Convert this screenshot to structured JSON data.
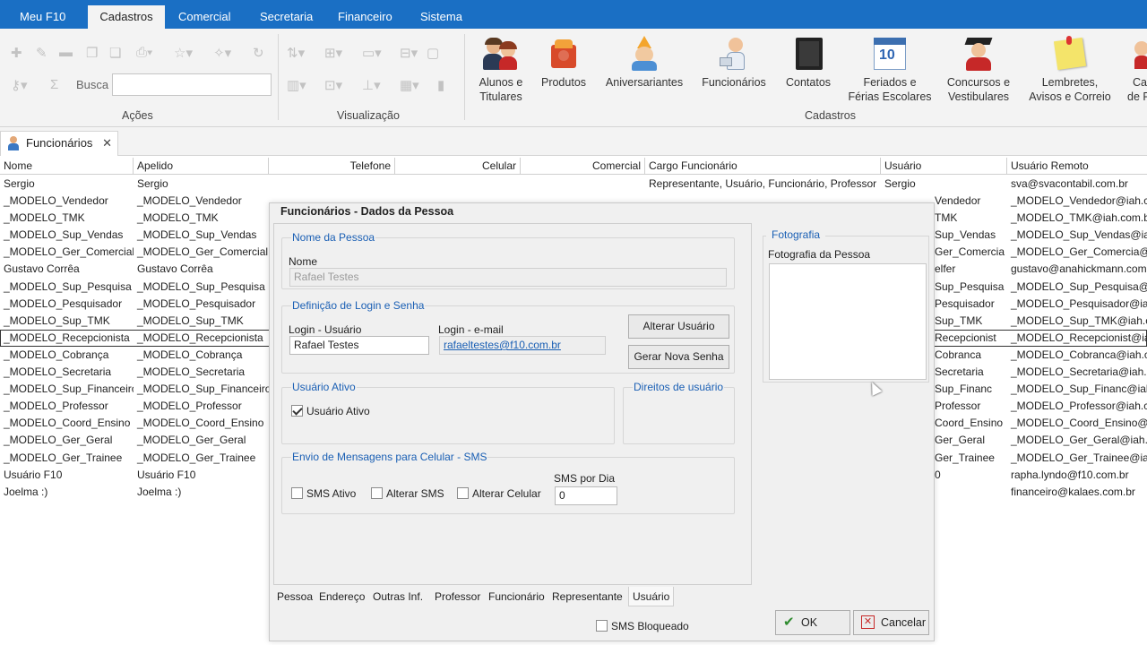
{
  "ribbon_tabs": [
    "Meu F10",
    "Cadastros",
    "Comercial",
    "Secretaria",
    "Financeiro",
    "Sistema"
  ],
  "ribbon": {
    "acoes_label": "Ações",
    "visualizacao_label": "Visualização",
    "cadastros_label": "Cadastros",
    "busca_label": "Busca",
    "busca_value": "",
    "buttons": [
      {
        "line1": "Alunos e",
        "line2": "Titulares",
        "icon": "students-icon"
      },
      {
        "line1": "Produtos",
        "line2": "",
        "icon": "products-icon"
      },
      {
        "line1": "Aniversariantes",
        "line2": "",
        "icon": "birthday-icon"
      },
      {
        "line1": "Funcionários",
        "line2": "",
        "icon": "employees-icon"
      },
      {
        "line1": "Contatos",
        "line2": "",
        "icon": "contacts-icon"
      },
      {
        "line1": "Feriados e",
        "line2": "Férias Escolares",
        "icon": "calendar-icon"
      },
      {
        "line1": "Concursos e",
        "line2": "Vestibulares",
        "icon": "graduation-icon"
      },
      {
        "line1": "Lembretes,",
        "line2": "Avisos e Correio",
        "icon": "notes-icon"
      },
      {
        "line1": "Ca",
        "line2": "de F",
        "icon": "more-icon"
      }
    ]
  },
  "doc_tab": {
    "label": "Funcionários",
    "close": "✕"
  },
  "grid": {
    "headers": [
      "Nome",
      "Apelido",
      "Telefone",
      "Celular",
      "Comercial",
      "Cargo Funcionário",
      "Usuário",
      "Usuário Remoto"
    ],
    "rows": [
      {
        "nome": "Sergio",
        "apelido": "Sergio",
        "cargo": "Representante, Usuário, Funcionário, Professor",
        "usuario": "Sergio",
        "remoto": "sva@svacontabil.com.br"
      },
      {
        "nome": "_MODELO_Vendedor",
        "apelido": "_MODELO_Vendedor",
        "cargo": "",
        "usuario": "Vendedor",
        "remoto": "_MODELO_Vendedor@iah.com.br"
      },
      {
        "nome": "_MODELO_TMK",
        "apelido": "_MODELO_TMK",
        "cargo": "",
        "usuario": "TMK",
        "remoto": "_MODELO_TMK@iah.com.br"
      },
      {
        "nome": "_MODELO_Sup_Vendas",
        "apelido": "_MODELO_Sup_Vendas",
        "cargo": "",
        "usuario": "Sup_Vendas",
        "remoto": "_MODELO_Sup_Vendas@iah.com.br"
      },
      {
        "nome": "_MODELO_Ger_Comercial",
        "apelido": "_MODELO_Ger_Comercial",
        "cargo": "",
        "usuario": "Ger_Comercia",
        "remoto": "_MODELO_Ger_Comercia@iah.com.br"
      },
      {
        "nome": "Gustavo Corrêa",
        "apelido": "Gustavo Corrêa",
        "cargo": "",
        "usuario": "elfer",
        "remoto": "gustavo@anahickmann.com.br"
      },
      {
        "nome": "_MODELO_Sup_Pesquisa",
        "apelido": "_MODELO_Sup_Pesquisa",
        "cargo": "",
        "usuario": "Sup_Pesquisa",
        "remoto": "_MODELO_Sup_Pesquisa@iah.com.br"
      },
      {
        "nome": "_MODELO_Pesquisador",
        "apelido": "_MODELO_Pesquisador",
        "cargo": "",
        "usuario": "Pesquisador",
        "remoto": "_MODELO_Pesquisador@iah.com.br"
      },
      {
        "nome": "_MODELO_Sup_TMK",
        "apelido": "_MODELO_Sup_TMK",
        "cargo": "",
        "usuario": "Sup_TMK",
        "remoto": "_MODELO_Sup_TMK@iah.com.br"
      },
      {
        "nome": "_MODELO_Recepcionista",
        "apelido": "_MODELO_Recepcionista",
        "cargo": "",
        "usuario": "Recepcionist",
        "remoto": "_MODELO_Recepcionist@iah.com.br",
        "selected": true
      },
      {
        "nome": "_MODELO_Cobrança",
        "apelido": "_MODELO_Cobrança",
        "cargo": "",
        "usuario": "Cobranca",
        "remoto": "_MODELO_Cobranca@iah.com.br"
      },
      {
        "nome": "_MODELO_Secretaria",
        "apelido": "_MODELO_Secretaria",
        "cargo": "",
        "usuario": "Secretaria",
        "remoto": "_MODELO_Secretaria@iah.com.br"
      },
      {
        "nome": "_MODELO_Sup_Financeiro",
        "apelido": "_MODELO_Sup_Financeiro",
        "cargo": "",
        "usuario": "Sup_Financ",
        "remoto": "_MODELO_Sup_Financ@iah.com.br"
      },
      {
        "nome": "_MODELO_Professor",
        "apelido": "_MODELO_Professor",
        "cargo": "",
        "usuario": "Professor",
        "remoto": "_MODELO_Professor@iah.com.br"
      },
      {
        "nome": "_MODELO_Coord_Ensino",
        "apelido": "_MODELO_Coord_Ensino",
        "cargo": "",
        "usuario": "Coord_Ensino",
        "remoto": "_MODELO_Coord_Ensino@iah.com.br"
      },
      {
        "nome": "_MODELO_Ger_Geral",
        "apelido": "_MODELO_Ger_Geral",
        "cargo": "",
        "usuario": "Ger_Geral",
        "remoto": "_MODELO_Ger_Geral@iah.com.br"
      },
      {
        "nome": "_MODELO_Ger_Trainee",
        "apelido": "_MODELO_Ger_Trainee",
        "cargo": "",
        "usuario": "Ger_Trainee",
        "remoto": "_MODELO_Ger_Trainee@iah.com.br"
      },
      {
        "nome": "Usuário F10",
        "apelido": "Usuário F10",
        "cargo": "",
        "usuario": "0",
        "remoto": "rapha.lyndo@f10.com.br"
      },
      {
        "nome": "Joelma :)",
        "apelido": "Joelma :)",
        "cargo": "",
        "usuario": "",
        "remoto": "financeiro@kalaes.com.br"
      }
    ]
  },
  "dialog": {
    "title": "Funcionários - Dados da Pessoa",
    "nome_pessoa": {
      "group": "Nome da Pessoa",
      "label": "Nome",
      "value": "Rafael Testes"
    },
    "login": {
      "group": "Definição de Login e Senha",
      "usuario_label": "Login - Usuário",
      "usuario_value": "Rafael Testes",
      "email_label": "Login - e-mail",
      "email_value": "rafaeltestes@f10.com.br",
      "alterar_usuario": "Alterar Usuário",
      "gerar_senha": "Gerar Nova Senha"
    },
    "usuario_ativo": {
      "group": "Usuário Ativo",
      "checkbox": "Usuário Ativo",
      "checked": true
    },
    "direitos": {
      "group": "Direitos de usuário"
    },
    "sms": {
      "group": "Envio de Mensagens para Celular - SMS",
      "sms_ativo": "SMS Ativo",
      "alterar_sms": "Alterar SMS",
      "alterar_celular": "Alterar Celular",
      "por_dia_label": "SMS por Dia",
      "por_dia_value": "0"
    },
    "tabs": [
      "Pessoa",
      "Endereço",
      "Outras Inf.",
      "Professor",
      "Funcionário",
      "Representante",
      "Usuário"
    ],
    "active_tab": "Usuário",
    "foto": {
      "group": "Fotografia",
      "label": "Fotografia da Pessoa"
    },
    "sms_bloqueado": "SMS Bloqueado",
    "ok": "OK",
    "cancelar": "Cancelar"
  },
  "colors": {
    "accent": "#1a6fc4",
    "group_title": "#1a5fb4"
  }
}
